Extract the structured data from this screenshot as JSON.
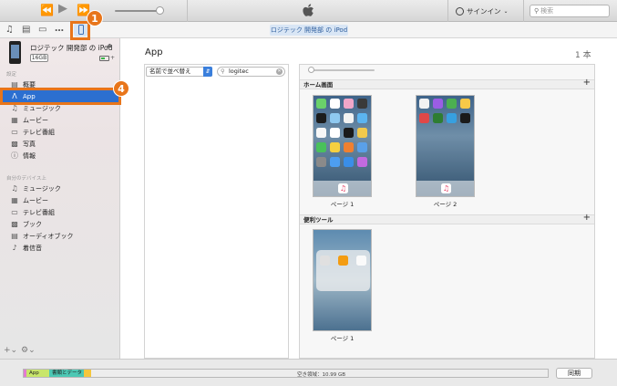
{
  "header": {
    "account": "サインイン",
    "search_placeholder": "検索"
  },
  "toolbar": {
    "device_tab": "ロジテック 開発部 の iPod"
  },
  "callouts": {
    "badge_1": "1",
    "badge_4": "4"
  },
  "sidebar": {
    "device_name": "ロジテック 開発部 の iPod",
    "capacity": "16GB",
    "settings_label": "設定",
    "settings_items": [
      {
        "label": "概要",
        "icon": "summary-icon"
      },
      {
        "label": "App",
        "icon": "app-store-icon"
      },
      {
        "label": "ミュージック",
        "icon": "music-note-icon"
      },
      {
        "label": "ムービー",
        "icon": "film-icon"
      },
      {
        "label": "テレビ番組",
        "icon": "tv-icon"
      },
      {
        "label": "写真",
        "icon": "camera-icon"
      },
      {
        "label": "情報",
        "icon": "info-icon"
      }
    ],
    "ondevice_label": "自分のデバイス上",
    "ondevice_items": [
      {
        "label": "ミュージック",
        "icon": "music-note-icon"
      },
      {
        "label": "ムービー",
        "icon": "film-icon"
      },
      {
        "label": "テレビ番組",
        "icon": "tv-icon"
      },
      {
        "label": "ブック",
        "icon": "book-icon"
      },
      {
        "label": "オーディオブック",
        "icon": "audiobook-icon"
      },
      {
        "label": "着信音",
        "icon": "bell-icon"
      }
    ]
  },
  "main": {
    "title": "App",
    "count": "1 本",
    "sort_label": "名前で並べ替え",
    "filter_value": "logitec",
    "sections": [
      {
        "title": "ホーム画面",
        "pages": [
          "ページ 1",
          "ページ 2"
        ]
      },
      {
        "title": "便利ツール",
        "pages": [
          "ページ 1"
        ]
      }
    ]
  },
  "status": {
    "segments": [
      {
        "label": "App",
        "color": "#c8e66a"
      },
      {
        "label": "書類とデータ",
        "color": "#4cc8b4"
      },
      {
        "label": "",
        "color": "#f5c63c"
      }
    ],
    "free_space": "空き領域：10.99 GB",
    "sync_label": "同期"
  },
  "colors": {
    "accent": "#2c6fd0",
    "callout": "#e8751a"
  }
}
